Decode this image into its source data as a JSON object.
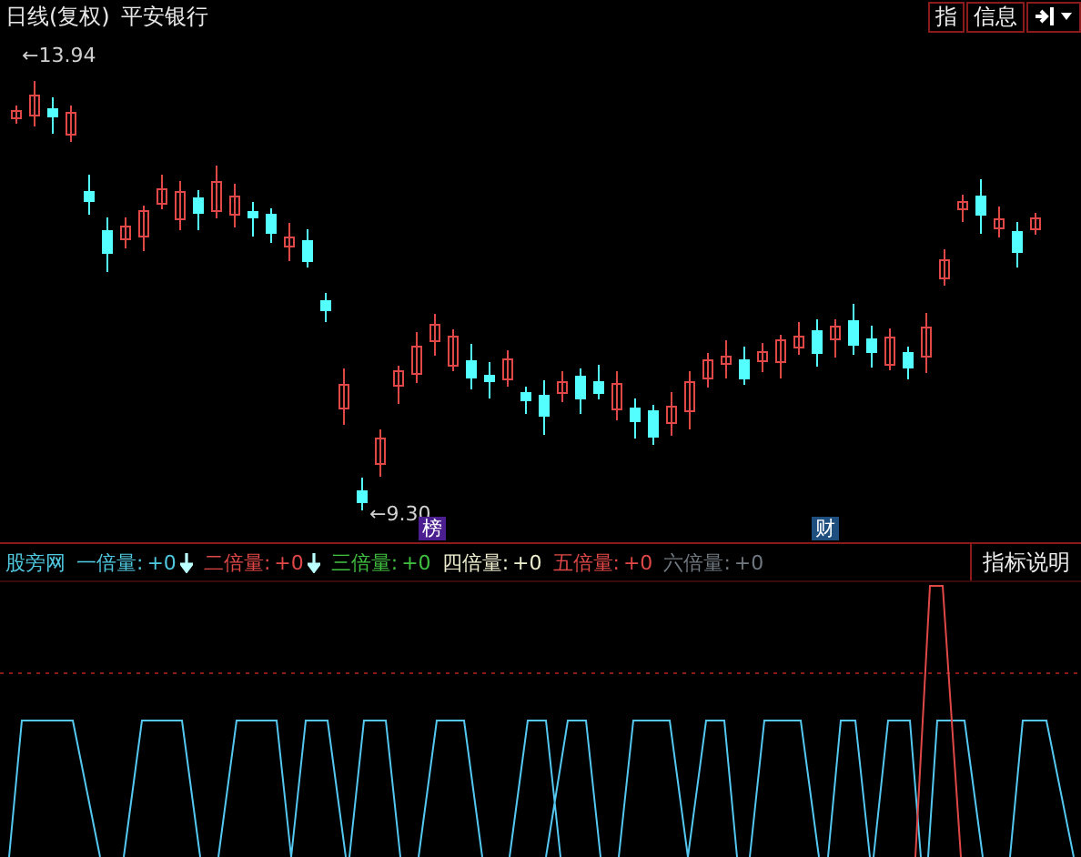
{
  "title": {
    "period": "日线(复权)",
    "stock": "平安银行"
  },
  "toolbar": {
    "buttons": [
      {
        "kind": "text",
        "label": "指"
      },
      {
        "kind": "text",
        "label": "信息"
      },
      {
        "kind": "icon"
      }
    ]
  },
  "price_chart": {
    "price_labels": [
      {
        "kind": "high",
        "text": "←13.94"
      },
      {
        "kind": "low",
        "text": "←9.30"
      }
    ],
    "markers": [
      {
        "text": "榜",
        "color": "#4b1f8f"
      },
      {
        "text": "财",
        "color": "#1f4f7f"
      }
    ]
  },
  "indicator": {
    "name": "股旁网",
    "legend": [
      {
        "label": "一倍量:",
        "value": "+0",
        "arrow": true,
        "color": "#4fc8e0"
      },
      {
        "label": "二倍量:",
        "value": "+0",
        "arrow": true,
        "color": "#e04848"
      },
      {
        "label": "三倍量:",
        "value": "+0",
        "arrow": false,
        "color": "#40c040"
      },
      {
        "label": "四倍量:",
        "value": "+0",
        "arrow": false,
        "color": "#f0f0d0"
      },
      {
        "label": "五倍量:",
        "value": "+0",
        "arrow": false,
        "color": "#e04848"
      },
      {
        "label": "六倍量:",
        "value": "+0",
        "arrow": false,
        "color": "#707880"
      }
    ],
    "help_button": "指标说明"
  }
}
